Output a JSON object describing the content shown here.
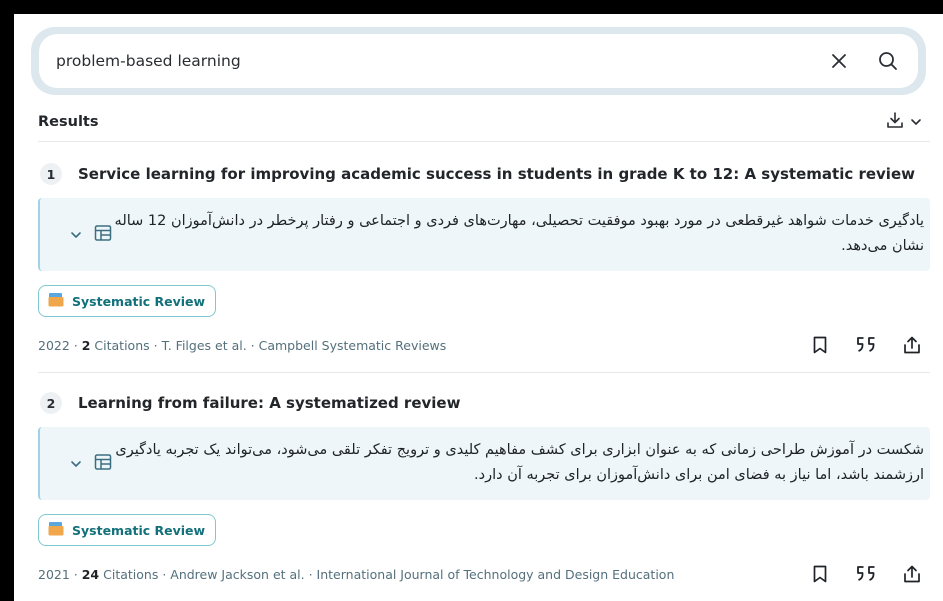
{
  "search": {
    "value": "problem-based learning",
    "clear_icon": "close-icon",
    "search_icon": "search-icon"
  },
  "results_header": {
    "title": "Results",
    "download_icon": "download-icon",
    "chevron_icon": "chevron-down-icon"
  },
  "results": [
    {
      "number": "1",
      "title": "Service learning for improving academic success in students in grade K to 12: A systematic review",
      "summary": "یادگیری خدمات شواهد غیرقطعی در مورد بهبود موفقیت تحصیلی، مهارت‌های فردی و اجتماعی و رفتار پرخطر در دانش‌آموزان 12 ساله نشان می‌دهد.",
      "badge": "Systematic Review",
      "year": "2022",
      "citations_count": "2",
      "citations_label": "Citations",
      "authors": "T. Filges et al.",
      "journal": "Campbell Systematic Reviews"
    },
    {
      "number": "2",
      "title": "Learning from failure: A systematized review",
      "summary": "شکست در آموزش طراحی زمانی که به عنوان ابزاری برای کشف مفاهیم کلیدی و ترویج تفکر تلقی می‌شود، می‌تواند یک تجربه یادگیری ارزشمند باشد، اما نیاز به فضای امن برای دانش‌آموزان برای تجربه آن دارد.",
      "badge": "Systematic Review",
      "year": "2021",
      "citations_count": "24",
      "citations_label": "Citations",
      "authors": "Andrew Jackson et al.",
      "journal": "International Journal of Technology and Design Education"
    }
  ],
  "colors": {
    "accent": "#12707a",
    "summary_bg": "#eef6fa",
    "summary_border": "#9fd2e6",
    "badge_border": "#7fc8cf",
    "meta_text": "#54707c"
  }
}
